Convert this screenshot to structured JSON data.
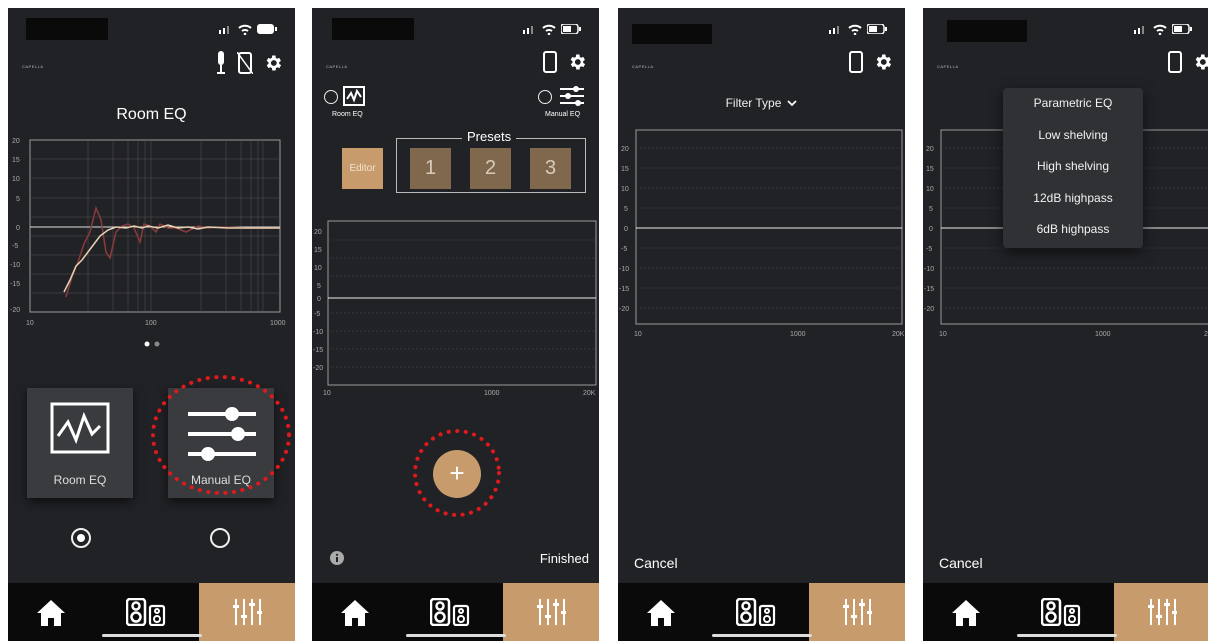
{
  "screens": {
    "s1": {
      "brand": "CAPELLA",
      "title": "Room EQ",
      "y_ticks": [
        "20",
        "15",
        "10",
        "5",
        "0",
        "-5",
        "-10",
        "-15",
        "-20"
      ],
      "x_ticks": [
        "10",
        "100",
        "1000"
      ],
      "tile_room": "Room EQ",
      "tile_manual": "Manual EQ",
      "selected": "Room EQ"
    },
    "s2": {
      "brand": "CAPELLA",
      "mode_room": "Room EQ",
      "mode_manual": "Manual EQ",
      "presets_label": "Presets",
      "editor": "Editor",
      "presets": [
        "1",
        "2",
        "3"
      ],
      "y_ticks": [
        "20",
        "15",
        "10",
        "5",
        "0",
        "-5",
        "-10",
        "-15",
        "-20"
      ],
      "x_ticks": [
        "10",
        "1000",
        "20K"
      ],
      "add": "+",
      "finished": "Finished"
    },
    "s3": {
      "brand": "CAPELLA",
      "filter_type": "Filter Type",
      "y_ticks": [
        "20",
        "15",
        "10",
        "5",
        "0",
        "-5",
        "-10",
        "-15",
        "-20"
      ],
      "x_ticks": [
        "10",
        "1000",
        "20K"
      ],
      "cancel": "Cancel"
    },
    "s4": {
      "brand": "CAPELLA",
      "menu": [
        "Parametric EQ",
        "Low shelving",
        "High shelving",
        "12dB highpass",
        "6dB highpass"
      ],
      "y_ticks": [
        "20",
        "15",
        "10",
        "5",
        "0",
        "-5",
        "-10",
        "-15",
        "-20"
      ],
      "x_ticks": [
        "10",
        "1000",
        "2"
      ],
      "cancel": "Cancel"
    }
  },
  "colors": {
    "background": "#212226",
    "accent": "#c79b6c",
    "preset": "#80684c",
    "highlight_ring": "#e0191c",
    "curve_light": "#e8d2b3",
    "curve_dark": "#8b3b3b"
  },
  "icons": [
    "microphone-icon",
    "phone-off-icon",
    "phone-icon",
    "gear-icon",
    "home-icon",
    "speaker-icon",
    "eq-sliders-icon",
    "info-icon",
    "chevron-down-icon",
    "room-eq-icon",
    "plus-icon"
  ]
}
